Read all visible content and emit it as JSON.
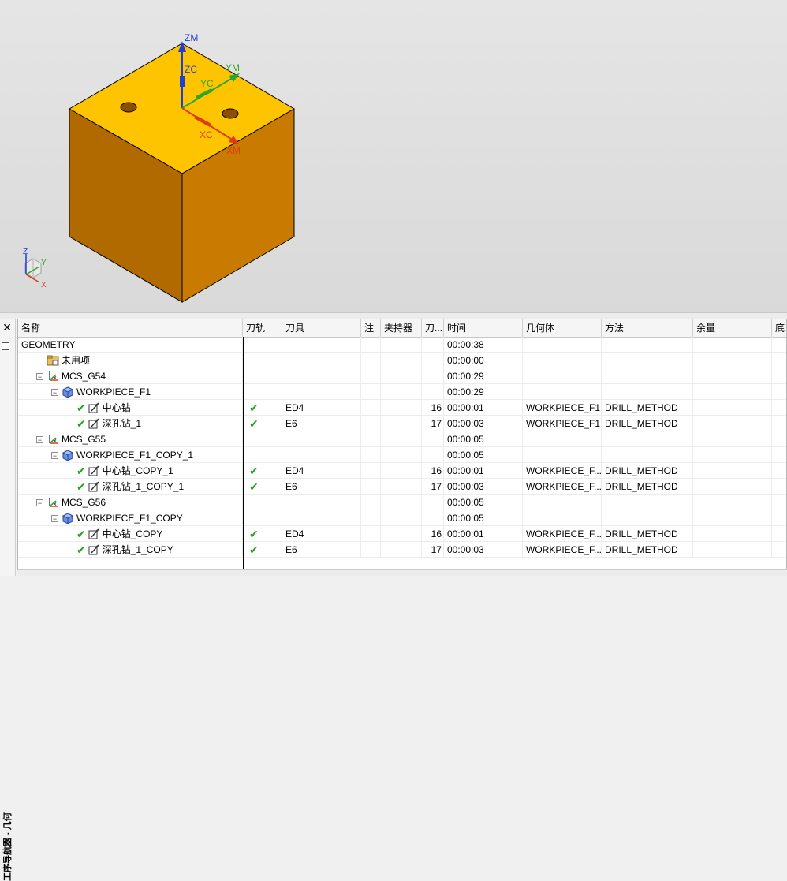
{
  "viewport": {
    "labels": {
      "zm": "ZM",
      "zc": "ZC",
      "yc": "YC",
      "ym": "YM",
      "xc": "XC",
      "xm": "XM",
      "triad_z": "Z",
      "triad_y": "Y",
      "triad_x": "X"
    },
    "colors": {
      "top_face": "#ffc400",
      "left_face": "#b06a00",
      "right_face": "#c97a00",
      "z_axis": "#1f3fd6",
      "y_axis": "#2ea52e",
      "x_axis": "#e03a1e"
    }
  },
  "sidebar": {
    "close_glyph": "✕",
    "vertical_title": "工序导航器 - 几何"
  },
  "navigator": {
    "columns": [
      "名称",
      "刀轨",
      "刀具",
      "注",
      "夹持器",
      "刀...",
      "时间",
      "几何体",
      "方法",
      "余量",
      "底"
    ],
    "rows": [
      {
        "name": "GEOMETRY",
        "path": "",
        "tool": "",
        "tool_num": "",
        "time": "00:00:38",
        "geometry": "",
        "method": "",
        "icon": "none"
      },
      {
        "name": "未用项",
        "path": "",
        "tool": "",
        "tool_num": "",
        "time": "00:00:00",
        "geometry": "",
        "method": "",
        "icon": "folder-icon"
      },
      {
        "name": "MCS_G54",
        "path": "",
        "tool": "",
        "tool_num": "",
        "time": "00:00:29",
        "geometry": "",
        "method": "",
        "icon": "mcs-icon"
      },
      {
        "name": "WORKPIECE_F1",
        "path": "",
        "tool": "",
        "tool_num": "",
        "time": "00:00:29",
        "geometry": "",
        "method": "",
        "icon": "workpiece-icon"
      },
      {
        "name": "中心钻",
        "path": "✔",
        "tool": "ED4",
        "tool_num": "16",
        "time": "00:00:01",
        "geometry": "WORKPIECE_F1",
        "method": "DRILL_METHOD",
        "icon": "operation-icon"
      },
      {
        "name": "深孔钻_1",
        "path": "✔",
        "tool": "E6",
        "tool_num": "17",
        "time": "00:00:03",
        "geometry": "WORKPIECE_F1",
        "method": "DRILL_METHOD",
        "icon": "operation-icon"
      },
      {
        "name": "MCS_G55",
        "path": "",
        "tool": "",
        "tool_num": "",
        "time": "00:00:05",
        "geometry": "",
        "method": "",
        "icon": "mcs-icon"
      },
      {
        "name": "WORKPIECE_F1_COPY_1",
        "path": "",
        "tool": "",
        "tool_num": "",
        "time": "00:00:05",
        "geometry": "",
        "method": "",
        "icon": "workpiece-icon"
      },
      {
        "name": "中心钻_COPY_1",
        "path": "✔",
        "tool": "ED4",
        "tool_num": "16",
        "time": "00:00:01",
        "geometry": "WORKPIECE_F...",
        "method": "DRILL_METHOD",
        "icon": "operation-icon"
      },
      {
        "name": "深孔钻_1_COPY_1",
        "path": "✔",
        "tool": "E6",
        "tool_num": "17",
        "time": "00:00:03",
        "geometry": "WORKPIECE_F...",
        "method": "DRILL_METHOD",
        "icon": "operation-icon"
      },
      {
        "name": "MCS_G56",
        "path": "",
        "tool": "",
        "tool_num": "",
        "time": "00:00:05",
        "geometry": "",
        "method": "",
        "icon": "mcs-icon"
      },
      {
        "name": "WORKPIECE_F1_COPY",
        "path": "",
        "tool": "",
        "tool_num": "",
        "time": "00:00:05",
        "geometry": "",
        "method": "",
        "icon": "workpiece-icon"
      },
      {
        "name": "中心钻_COPY",
        "path": "✔",
        "tool": "ED4",
        "tool_num": "16",
        "time": "00:00:01",
        "geometry": "WORKPIECE_F...",
        "method": "DRILL_METHOD",
        "icon": "operation-icon"
      },
      {
        "name": "深孔钻_1_COPY",
        "path": "✔",
        "tool": "E6",
        "tool_num": "17",
        "time": "00:00:03",
        "geometry": "WORKPIECE_F...",
        "method": "DRILL_METHOD",
        "icon": "operation-icon"
      }
    ]
  }
}
